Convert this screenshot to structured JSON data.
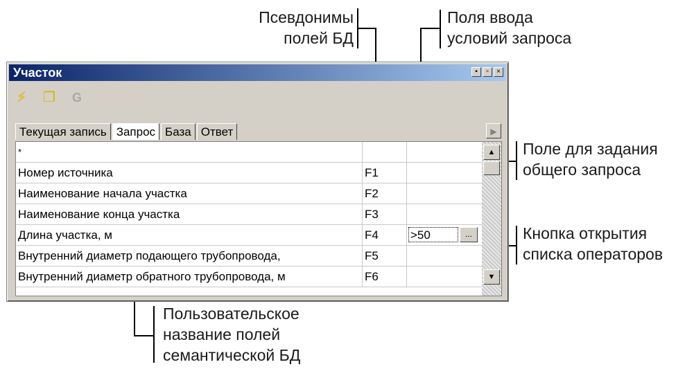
{
  "annotations": {
    "aliases": [
      "Псевдонимы",
      "полей БД"
    ],
    "input_fields": [
      "Поля ввода",
      "условий запроса"
    ],
    "general_query": [
      "Поле для задания",
      "общего запроса"
    ],
    "operators_button": [
      "Кнопка открытия",
      "списка операторов"
    ],
    "user_name": [
      "Пользовательское",
      "название полей",
      "семантической БД"
    ]
  },
  "window": {
    "title": "Участок",
    "title_buttons": [
      "▪",
      "▫",
      "×"
    ]
  },
  "toolbar": {
    "icons": [
      "lightning-icon",
      "copy-folder-icon",
      "g-icon"
    ],
    "g_label": "G"
  },
  "tabs": [
    {
      "label": "Текущая запись",
      "active": false
    },
    {
      "label": "Запрос",
      "active": true
    },
    {
      "label": "База",
      "active": false
    },
    {
      "label": "Ответ",
      "active": false
    }
  ],
  "grid": {
    "rows": [
      {
        "name": "*",
        "alias": "",
        "condition": ""
      },
      {
        "name": "Номер источника",
        "alias": "F1",
        "condition": ""
      },
      {
        "name": "Наименование начала участка",
        "alias": "F2",
        "condition": ""
      },
      {
        "name": "Наименование конца участка",
        "alias": "F3",
        "condition": ""
      },
      {
        "name": "Длина участка, м",
        "alias": "F4",
        "condition": ">50"
      },
      {
        "name": "Внутренний диаметр подающего трубопровода,",
        "alias": "F5",
        "condition": ""
      },
      {
        "name": "Внутренний диаметр обратного трубопровода, м",
        "alias": "F6",
        "condition": ""
      }
    ],
    "operator_button_label": "..."
  }
}
